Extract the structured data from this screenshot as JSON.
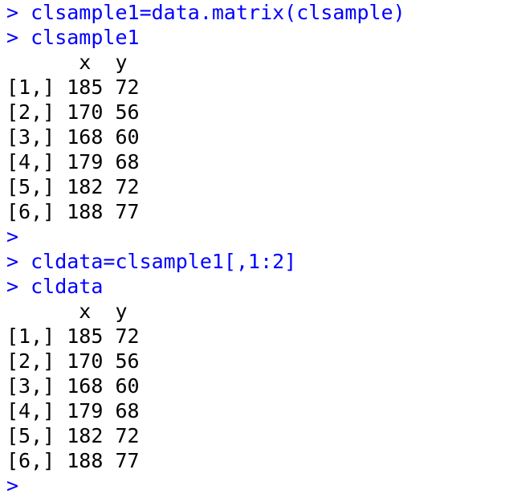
{
  "console": {
    "input_color": "#0000ff",
    "output_color": "#000000",
    "lines": [
      {
        "type": "input",
        "text": "> clsample1=data.matrix(clsample)"
      },
      {
        "type": "input",
        "text": "> clsample1"
      },
      {
        "type": "output",
        "text": "      x  y"
      },
      {
        "type": "output",
        "text": "[1,] 185 72"
      },
      {
        "type": "output",
        "text": "[2,] 170 56"
      },
      {
        "type": "output",
        "text": "[3,] 168 60"
      },
      {
        "type": "output",
        "text": "[4,] 179 68"
      },
      {
        "type": "output",
        "text": "[5,] 182 72"
      },
      {
        "type": "output",
        "text": "[6,] 188 77"
      },
      {
        "type": "input",
        "text": ">"
      },
      {
        "type": "input",
        "text": "> cldata=clsample1[,1:2]"
      },
      {
        "type": "input",
        "text": "> cldata"
      },
      {
        "type": "output",
        "text": "      x  y"
      },
      {
        "type": "output",
        "text": "[1,] 185 72"
      },
      {
        "type": "output",
        "text": "[2,] 170 56"
      },
      {
        "type": "output",
        "text": "[3,] 168 60"
      },
      {
        "type": "output",
        "text": "[4,] 179 68"
      },
      {
        "type": "output",
        "text": "[5,] 182 72"
      },
      {
        "type": "output",
        "text": "[6,] 188 77"
      },
      {
        "type": "input",
        "text": ">"
      }
    ]
  }
}
